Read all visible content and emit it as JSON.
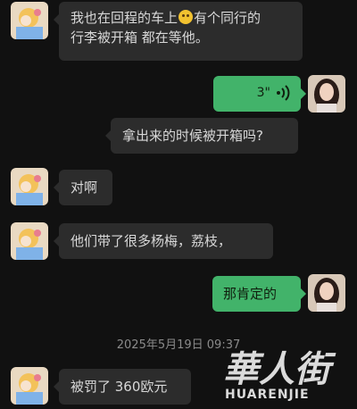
{
  "colors": {
    "background": "#111111",
    "incoming_bubble": "#2c2c2c",
    "outgoing_bubble": "#42b36a",
    "timestamp": "#8a8a8a"
  },
  "messages": [
    {
      "side": "incoming",
      "line1_before_emoji": "我也在回程的车上",
      "emoji_icon": "grinning-face-emoji",
      "line1_after_emoji": "有个同行的",
      "line2": "行李被开箱 都在等他。"
    },
    {
      "side": "outgoing",
      "type": "voice",
      "duration": "3\"",
      "icon": "voice-wave-icon"
    },
    {
      "side": "incoming",
      "text": "拿出来的时候被开箱吗?"
    },
    {
      "side": "incoming",
      "text": "对啊"
    },
    {
      "side": "incoming",
      "text": "他们带了很多杨梅，荔枝，"
    },
    {
      "side": "outgoing",
      "text": "那肯定的"
    },
    {
      "side": "incoming",
      "text": "被罚了 360欧元"
    }
  ],
  "timestamp": "2025年5月19日 09:37",
  "watermark": {
    "chinese": "華人街",
    "english": "HUARENJIE"
  }
}
